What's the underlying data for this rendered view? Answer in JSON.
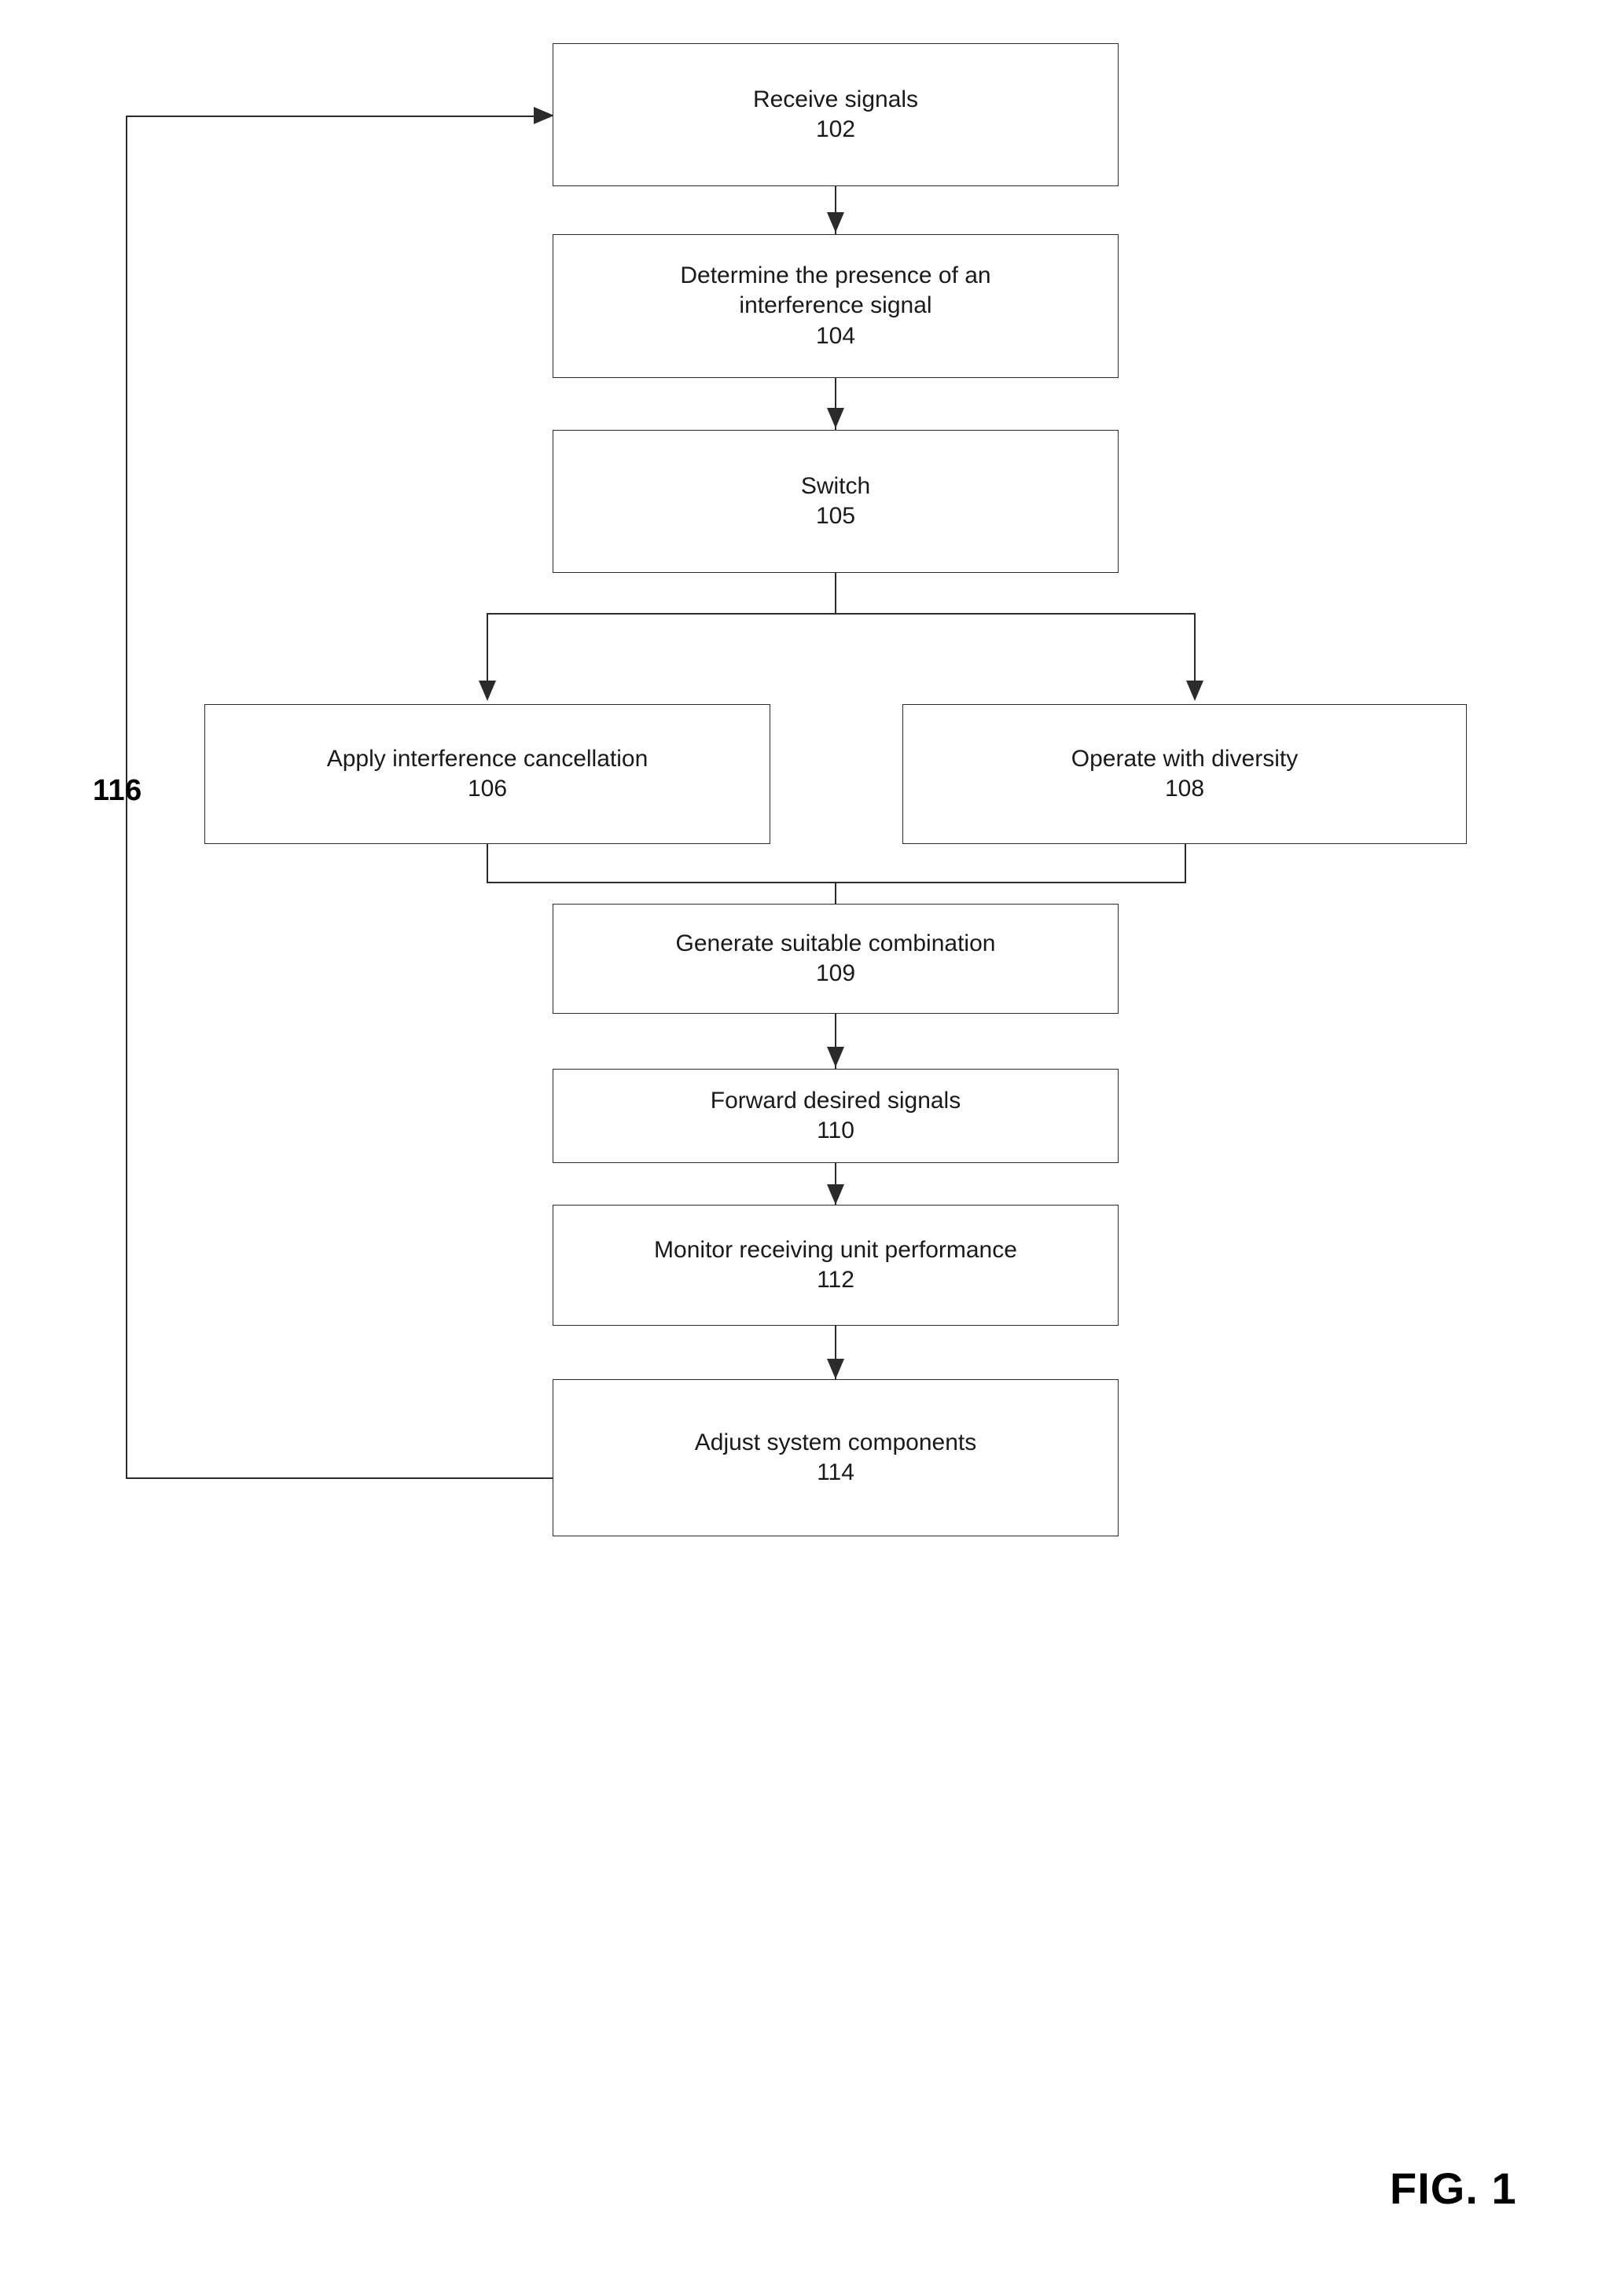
{
  "figure": {
    "caption": "FIG. 1",
    "loop_reference_numeral": "116"
  },
  "nodes": [
    {
      "id": "n102",
      "label": "Receive signals",
      "number": "102"
    },
    {
      "id": "n104",
      "label": "Determine the presence of an\ninterference signal",
      "number": "104"
    },
    {
      "id": "n105",
      "label": "Switch",
      "number": "105"
    },
    {
      "id": "n106",
      "label": "Apply interference cancellation",
      "number": "106"
    },
    {
      "id": "n108",
      "label": "Operate with diversity",
      "number": "108"
    },
    {
      "id": "n109",
      "label": "Generate suitable combination",
      "number": "109"
    },
    {
      "id": "n110",
      "label": "Forward desired signals",
      "number": "110"
    },
    {
      "id": "n112",
      "label": "Monitor receiving unit performance",
      "number": "112"
    },
    {
      "id": "n114",
      "label": "Adjust system components",
      "number": "114"
    }
  ],
  "colors": {
    "stroke": "#2b2b2b",
    "text": "#1a1a1a",
    "background": "#ffffff"
  }
}
